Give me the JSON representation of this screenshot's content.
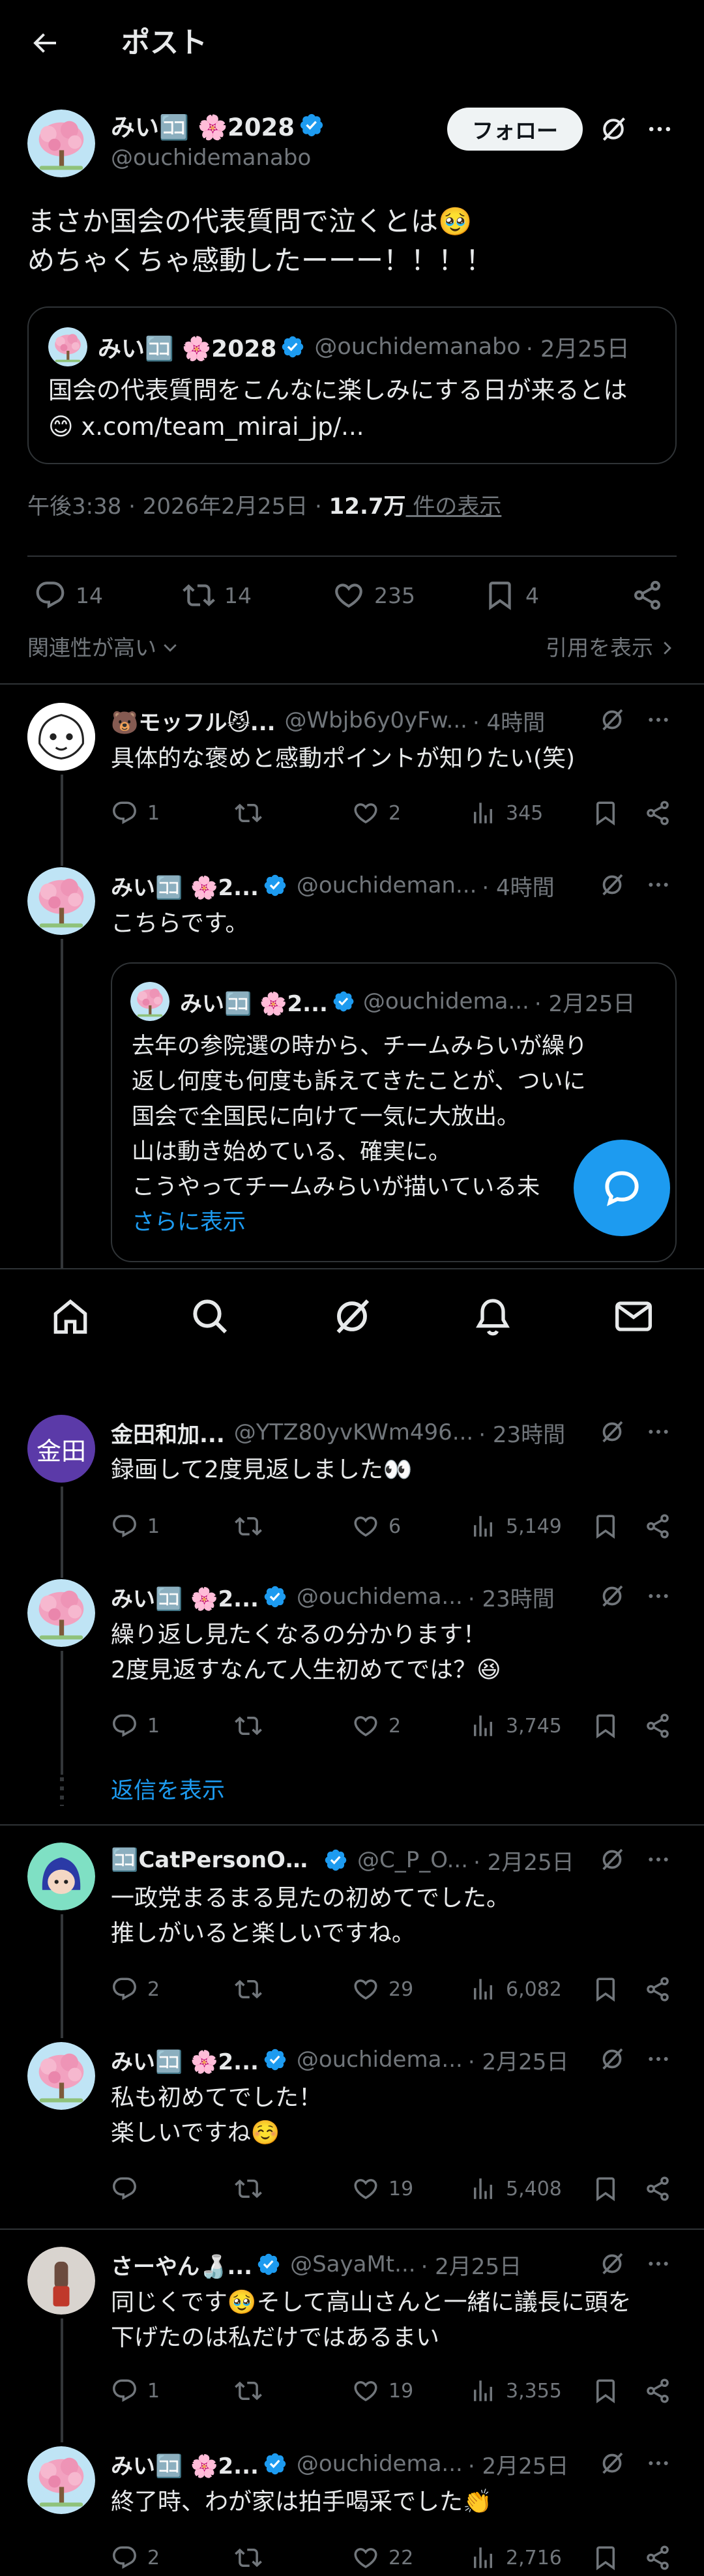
{
  "header": {
    "title": "ポスト"
  },
  "main_post": {
    "author_name": "みい🈁 🌸2028",
    "handle": "@ouchidemanabo",
    "follow_label": "フォロー",
    "text_line1": "まさか国会の代表質問で泣くとは🥹",
    "text_line2": "めちゃくちゃ感動したーーー！！！！",
    "quote": {
      "author_name": "みい🈁 🌸2028",
      "handle": "@ouchidemanabo",
      "date": "· 2月25日",
      "text_line1": "国会の代表質問をこんなに楽しみにする日が来るとは",
      "text_line2": "😊 x.com/team_mirai_jp/..."
    },
    "meta_time": "午後3:38 · 2026年2月25日 · ",
    "meta_views": "12.7万",
    "meta_views_label": " 件の表示",
    "stats": {
      "replies": "14",
      "reposts": "14",
      "likes": "235",
      "bookmarks": "4"
    },
    "sort_label": "関連性が高い",
    "show_quotes": "引用を表示"
  },
  "replies": [
    {
      "name": "🐻モッフル😼...",
      "handle": "@Wbjb6y0yFw...",
      "time": "· 4時間",
      "lines": [
        "具体的な褒めと感動ポイントが知りたい(笑)"
      ],
      "replies": "1",
      "reposts": "",
      "likes": "2",
      "views": "345"
    },
    {
      "name": "みい🈁 🌸2...",
      "handle": "@ouchideman...",
      "time": "· 4時間",
      "lines": [
        "こちらです。"
      ],
      "quote": {
        "name": "みい🈁 🌸2...",
        "handle": "@ouchidema...",
        "date": "· 2月25日",
        "lines": [
          "去年の参院選の時から、チームみらいが繰り",
          "返し何度も何度も訴えてきたことが、ついに",
          "国会で全国民に向けて一気に大放出。",
          "山は動き始めている、確実に。",
          "こうやってチームみらいが描いている未"
        ],
        "show_more": "さらに表示"
      }
    },
    {
      "avatar_text": "金田",
      "name": "金田和加...",
      "handle": "@YTZ80yvKWm496...",
      "time": "· 23時間",
      "lines": [
        "録画して2度見返しました👀"
      ],
      "replies": "1",
      "reposts": "",
      "likes": "6",
      "views": "5,149"
    },
    {
      "name": "みい🈁 🌸2...",
      "handle": "@ouchidema...",
      "time": "· 23時間",
      "lines": [
        "繰り返し見たくなるの分かります！",
        "2度見返すなんて人生初めてでは？😆"
      ],
      "replies": "1",
      "reposts": "",
      "likes": "2",
      "views": "3,745"
    },
    {
      "show_replies": "返信を表示"
    },
    {
      "name": "🈁CatPersonOpt...",
      "handle": "@C_P_O...",
      "time": "· 2月25日",
      "lines": [
        "一政党まるまる見たの初めてでした。",
        "推しがいると楽しいですね。"
      ],
      "replies": "2",
      "reposts": "",
      "likes": "29",
      "views": "6,082"
    },
    {
      "name": "みい🈁 🌸2...",
      "handle": "@ouchidema...",
      "time": "· 2月25日",
      "lines": [
        "私も初めてでした！",
        "楽しいですね☺️"
      ],
      "replies": "",
      "reposts": "",
      "likes": "19",
      "views": "5,408"
    },
    {
      "name": "さーやん🍶...",
      "handle": "@SayaMt...",
      "time": "· 2月25日",
      "lines": [
        "同じくです🥹そして高山さんと一緒に議長に頭を",
        "下げたのは私だけではあるまい"
      ],
      "replies": "1",
      "reposts": "",
      "likes": "19",
      "views": "3,355"
    },
    {
      "name": "みい🈁 🌸2...",
      "handle": "@ouchidema...",
      "time": "· 2月25日",
      "lines": [
        "終了時、わが家は拍手喝采でした👏"
      ],
      "replies": "2",
      "reposts": "",
      "likes": "22",
      "views": "2,716"
    }
  ],
  "colors": {
    "accent": "#1d9bf0",
    "background": "#000000",
    "text": "#e7e9ea",
    "muted": "#71767b",
    "border": "#2f3336"
  },
  "icons": [
    "back-arrow-icon",
    "grok-icon",
    "more-icon",
    "verified-icon",
    "reply-icon",
    "repost-icon",
    "like-icon",
    "bookmark-icon",
    "share-icon",
    "views-icon",
    "home-icon",
    "search-icon",
    "notifications-icon",
    "messages-icon",
    "compose-reply-icon"
  ]
}
